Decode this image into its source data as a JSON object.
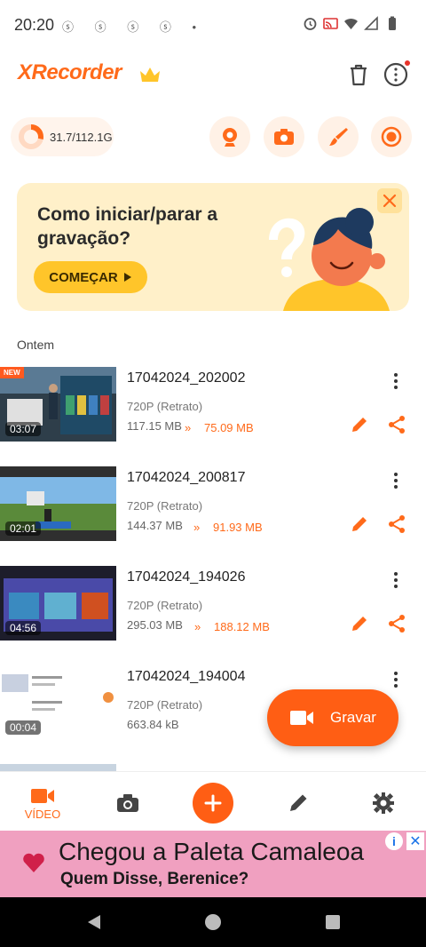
{
  "status_bar": {
    "time": "20:20",
    "notification_icons": "ⓢ ⓢ ⓢ ⓢ •"
  },
  "header": {
    "app_title": "XRecorder"
  },
  "storage": {
    "text": "31.7/112.1G",
    "used_fraction": 0.283
  },
  "banner": {
    "title": "Como iniciar/parar a gravação?",
    "button_label": "COMEÇAR"
  },
  "section": {
    "label": "Ontem"
  },
  "recordings": [
    {
      "name": "17042024_202002",
      "resolution": "720P (Retrato)",
      "size": "117.15 MB",
      "compressed": "75.09 MB",
      "duration": "03:07",
      "badge": "NEW"
    },
    {
      "name": "17042024_200817",
      "resolution": "720P (Retrato)",
      "size": "144.37 MB",
      "compressed": "91.93 MB",
      "duration": "02:01"
    },
    {
      "name": "17042024_194026",
      "resolution": "720P (Retrato)",
      "size": "295.03 MB",
      "compressed": "188.12 MB",
      "duration": "04:56"
    },
    {
      "name": "17042024_194004",
      "resolution": "720P (Retrato)",
      "size": "663.84 kB",
      "duration": "00:04"
    }
  ],
  "fab": {
    "label": "Gravar"
  },
  "bottom_nav": {
    "video_label": "VÍDEO"
  },
  "ad": {
    "title": "Chegou a Paleta Camaleoa",
    "subtitle": "Quem Disse, Berenice?",
    "info": "i",
    "close": "✕"
  },
  "colors": {
    "accent": "#ff6a1a",
    "banner_bg": "#fff0c9",
    "banner_button": "#ffc52a",
    "ad_bg": "#f0a0c0"
  }
}
